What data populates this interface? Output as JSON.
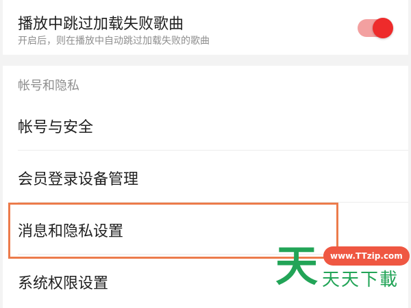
{
  "skip_failed": {
    "title": "播放中跳过加载失败歌曲",
    "description": "开启后，则在播放中自动跳过加载失败的歌曲",
    "enabled": true
  },
  "account_section": {
    "header": "帐号和隐私",
    "items": [
      {
        "label": "帐号与安全"
      },
      {
        "label": "会员登录设备管理"
      },
      {
        "label": "消息和隐私设置"
      },
      {
        "label": "系统权限设置"
      }
    ]
  },
  "colors": {
    "accent": "#ee2b2b",
    "highlight": "#ec7b4b",
    "watermark_green": "#22a457",
    "watermark_red": "#ef5742"
  },
  "watermark": {
    "url": "www.TTzip.com",
    "logo_char": "天",
    "name": "天天下載"
  }
}
